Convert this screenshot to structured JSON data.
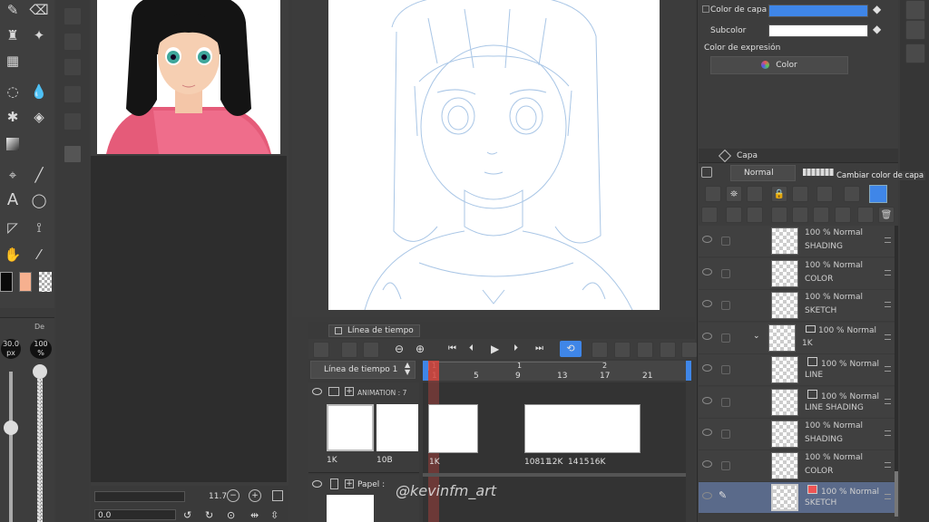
{
  "tool_palette": {
    "icons": [
      "pen-icon",
      "eraser-icon",
      "fill-icon",
      "sparkle-icon",
      "grid-icon",
      "lasso-icon",
      "drop-icon",
      "drops-icon",
      "magic-wand-icon",
      "bucket-icon",
      "gradient-icon",
      "select-icon",
      "line-icon",
      "text-icon",
      "balloon-icon",
      "triangle-ruler-icon",
      "perspective-icon",
      "hand-icon",
      "eyedropper-icon"
    ],
    "main_color": "#0a0a0a",
    "sub_color": "#f6b08f",
    "brush_size": "30.0",
    "brush_size_unit": "px",
    "opacity": "100",
    "opacity_unit": "%",
    "tab_label": "De"
  },
  "navigator": {
    "zoom_value": "11.7",
    "angle_value": "0.0"
  },
  "color_panel": {
    "layer_color_label": "Color de capa",
    "layer_color": "#3f86e8",
    "subcolor_label": "Subcolor",
    "subcolor": "#ffffff",
    "expression_label": "Color de expresión",
    "expression_value": "Color"
  },
  "layer_panel": {
    "tab_label": "Capa",
    "blend_mode": "Normal",
    "tooltip": "Cambiar color de capa",
    "layers": [
      {
        "opacity": "100 %",
        "mode": "Normal",
        "name": "SHADING",
        "type": "raster"
      },
      {
        "opacity": "100 %",
        "mode": "Normal",
        "name": "COLOR",
        "type": "raster"
      },
      {
        "opacity": "100 %",
        "mode": "Normal",
        "name": "SKETCH",
        "type": "raster"
      },
      {
        "opacity": "100 %",
        "mode": "Normal",
        "name": "1K",
        "type": "folder"
      },
      {
        "opacity": "100 %",
        "mode": "Normal",
        "name": "LINE",
        "type": "vector"
      },
      {
        "opacity": "100 %",
        "mode": "Normal",
        "name": "LINE SHADING",
        "type": "vector"
      },
      {
        "opacity": "100 %",
        "mode": "Normal",
        "name": "SHADING",
        "type": "raster"
      },
      {
        "opacity": "100 %",
        "mode": "Normal",
        "name": "COLOR",
        "type": "raster"
      },
      {
        "opacity": "100 %",
        "mode": "Normal",
        "name": "SKETCH",
        "type": "raster",
        "selected": true
      }
    ]
  },
  "timeline": {
    "tab_label": "Línea de tiempo",
    "timeline_name": "Línea de tiempo 1",
    "frame_numbers": [
      "1",
      "5",
      "9",
      "13",
      "17",
      "21"
    ],
    "section_marks": [
      "1",
      "1",
      "2"
    ],
    "animation_folder_label": "ANIMATION : 7",
    "paper_label": "Papel :",
    "cel_labels": [
      "1K",
      "10B",
      "1K",
      "10811",
      "12K",
      "14",
      "15",
      "16K"
    ]
  },
  "watermark": "@kevinfm_art"
}
